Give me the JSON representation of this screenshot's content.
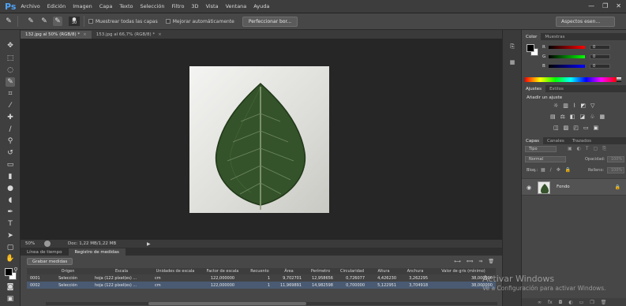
{
  "app": {
    "logo": "Ps"
  },
  "menu": [
    "Archivo",
    "Edición",
    "Imagen",
    "Capa",
    "Texto",
    "Selección",
    "Filtro",
    "3D",
    "Vista",
    "Ventana",
    "Ayuda"
  ],
  "window_controls": {
    "minimize": "—",
    "restore": "❐",
    "close": "✕"
  },
  "options_bar": {
    "size_value": "30",
    "sample_all_layers_label": "Muestrear todas las capas",
    "auto_enhance_label": "Mejorar automáticamente",
    "refine_edge_label": "Perfeccionar bor...",
    "workspace_label": "Aspectos esen..."
  },
  "tabs": [
    {
      "label": "132.jpg al 50% (RGB/8) *",
      "close": "×"
    },
    {
      "label": "153.jpg al 66,7% (RGB/8) *",
      "close": "×"
    }
  ],
  "status": {
    "zoom": "50%",
    "doc_info": "Doc: 1,22 MB/1,22 MB",
    "arrow": "▶"
  },
  "bottom_tabs": [
    "Línea de tiempo",
    "Registro de medidas"
  ],
  "measurement": {
    "record_label": "Grabar medidas",
    "columns": [
      "",
      "Origen",
      "Escala",
      "Unidades de escala",
      "Factor de escala",
      "Recuento",
      "Área",
      "Perímetro",
      "Circularidad",
      "Altura",
      "Anchura",
      "Valor de gris (mínimo)"
    ],
    "rows": [
      [
        "0001",
        "Selección",
        "hoja (122 píxel(es) ...",
        "cm",
        "122,000000",
        "1",
        "9,702701",
        "12,958656",
        "0,726077",
        "4,426230",
        "3,262295",
        "38,000000"
      ],
      [
        "0002",
        "Selección",
        "hoja (122 píxel(es) ...",
        "cm",
        "122,000000",
        "1",
        "11,969891",
        "14,982598",
        "0,700000",
        "5,122951",
        "3,704918",
        "38,000000"
      ]
    ]
  },
  "color_panel": {
    "tabs": [
      "Color",
      "Muestras"
    ],
    "channels": [
      {
        "label": "R",
        "value": "0"
      },
      {
        "label": "G",
        "value": "0"
      },
      {
        "label": "B",
        "value": "0"
      }
    ]
  },
  "adjust_panel": {
    "tabs": [
      "Ajustes",
      "Estilos"
    ],
    "title": "Añadir un ajuste"
  },
  "layers_panel": {
    "tabs": [
      "Capas",
      "Canales",
      "Trazados"
    ],
    "kind_filter": "Tipo",
    "blend_mode": "Normal",
    "opacity_label": "Opacidad:",
    "opacity_value": "100%",
    "lock_label": "Bloq.:",
    "fill_label": "Relleno:",
    "fill_value": "100%",
    "layer_name": "Fondo"
  },
  "watermark": {
    "line1": "Activar Windows",
    "line2": "Ve a Configuración para activar Windows."
  },
  "colors": {
    "accent_logo": "#4fa3f7",
    "selected_row": "#4a5a72",
    "leaf_dark": "#2e4a24"
  }
}
